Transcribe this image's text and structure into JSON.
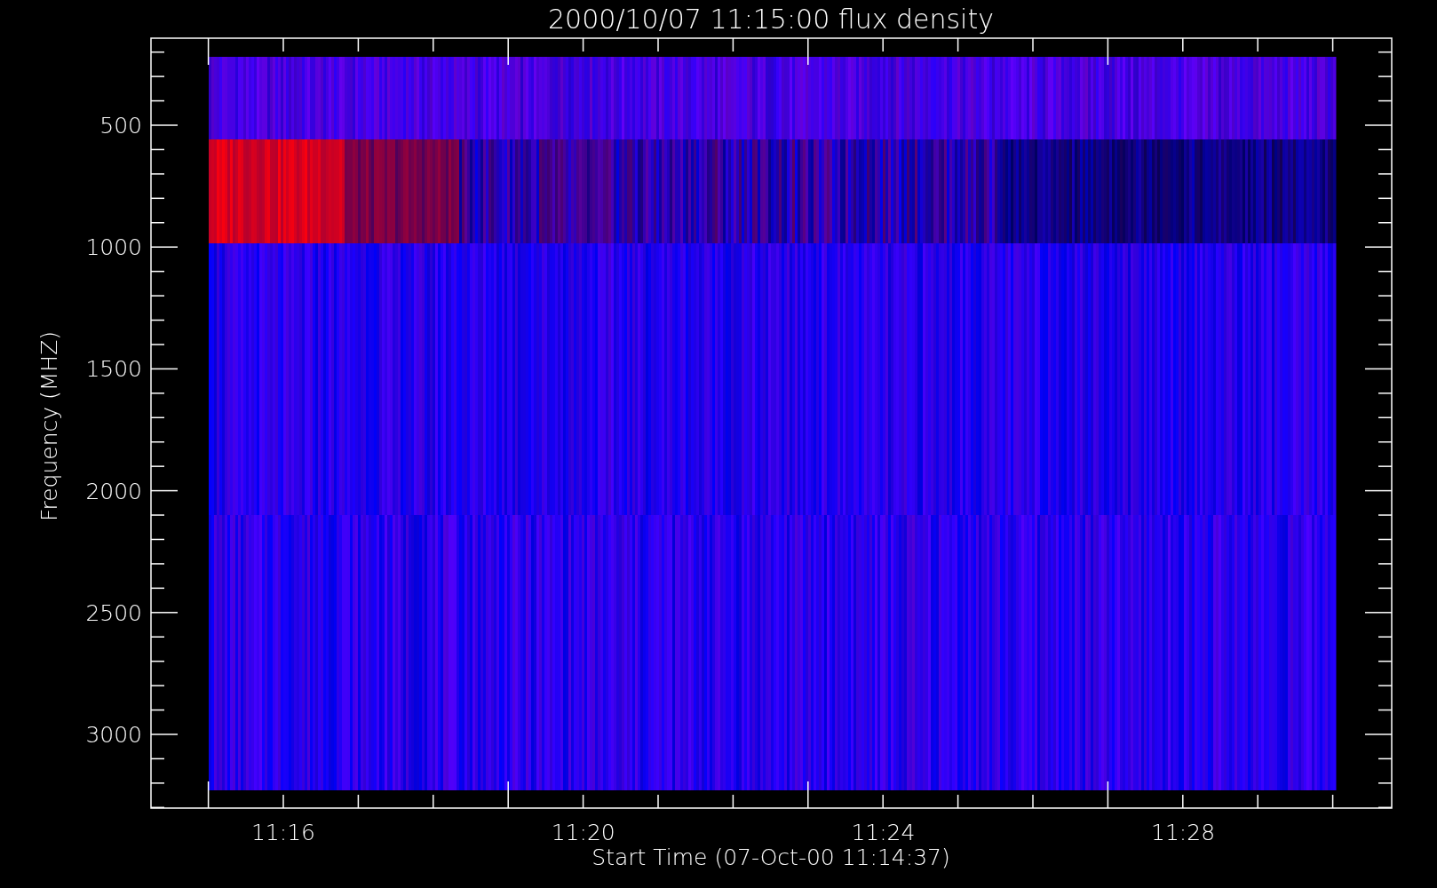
{
  "plot": {
    "title": "2000/10/07 11:15:00 flux density",
    "xlabel": "Start Time (07-Oct-00 11:14:37)",
    "ylabel": "Frequency (MHZ)",
    "yticks": [
      "500",
      "1000",
      "1500",
      "2000",
      "2500",
      "3000"
    ],
    "xticks": [
      "11:16",
      "11:20",
      "11:24",
      "11:28"
    ]
  }
}
